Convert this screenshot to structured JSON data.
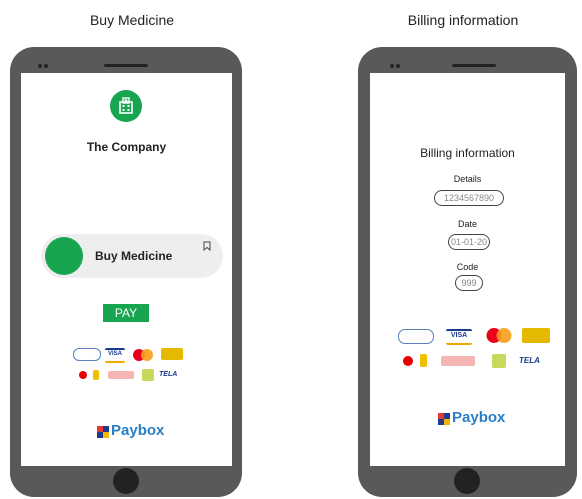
{
  "left": {
    "caption": "Buy Medicine",
    "company_name": "The Company",
    "medicine_label": "Buy Medicine",
    "pay_label": "PAY",
    "paybox_label": "Paybox"
  },
  "right": {
    "caption": "Billing information",
    "title": "Billing information",
    "details_label": "Details",
    "details_value": "1234567890",
    "date_label": "Date",
    "date_value": "01-01-20",
    "code_label": "Code",
    "code_value": "999",
    "paybox_label": "Paybox"
  },
  "payment_logos": [
    "girokart-logo",
    "visa-logo",
    "mastercard-logo",
    "mpesa-logo",
    "vodafone-logo",
    "mtn-logo",
    "airtel-tigo-logo",
    "ecocash-logo",
    "tela-logo"
  ],
  "logo_text": {
    "visa": "VISA",
    "tela": "TELA"
  },
  "colors": {
    "accent_green": "#18a550",
    "phone_body": "#58595b",
    "paybox_blue": "#2a7fc6"
  }
}
